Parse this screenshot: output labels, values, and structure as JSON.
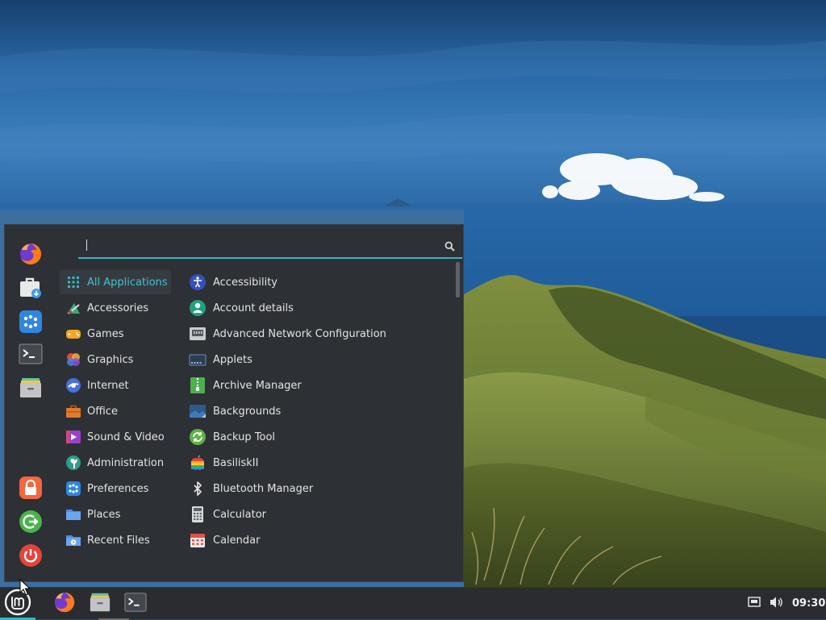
{
  "search": {
    "value": "",
    "placeholder": ""
  },
  "favorites": [
    {
      "name": "Firefox",
      "icon": "firefox-icon"
    },
    {
      "name": "Software Manager",
      "icon": "software-manager-icon"
    },
    {
      "name": "System Settings",
      "icon": "settings-icon"
    },
    {
      "name": "Terminal",
      "icon": "terminal-icon"
    },
    {
      "name": "Files",
      "icon": "files-icon"
    }
  ],
  "session": [
    {
      "name": "Lock Screen",
      "icon": "lock-icon"
    },
    {
      "name": "Log Out",
      "icon": "logout-icon"
    },
    {
      "name": "Quit",
      "icon": "power-icon"
    }
  ],
  "categories": [
    {
      "label": "All Applications",
      "icon": "grid-icon",
      "selected": true
    },
    {
      "label": "Accessories",
      "icon": "accessories-icon"
    },
    {
      "label": "Games",
      "icon": "gamepad-icon"
    },
    {
      "label": "Graphics",
      "icon": "graphics-icon"
    },
    {
      "label": "Internet",
      "icon": "internet-icon"
    },
    {
      "label": "Office",
      "icon": "briefcase-icon"
    },
    {
      "label": "Sound & Video",
      "icon": "media-icon"
    },
    {
      "label": "Administration",
      "icon": "administration-icon"
    },
    {
      "label": "Preferences",
      "icon": "preferences-icon"
    },
    {
      "label": "Places",
      "icon": "folder-icon"
    },
    {
      "label": "Recent Files",
      "icon": "recent-files-icon"
    }
  ],
  "apps": [
    {
      "label": "Accessibility",
      "icon": "accessibility-icon"
    },
    {
      "label": "Account details",
      "icon": "account-icon"
    },
    {
      "label": "Advanced Network Configuration",
      "icon": "network-icon"
    },
    {
      "label": "Applets",
      "icon": "applets-icon"
    },
    {
      "label": "Archive Manager",
      "icon": "archive-icon"
    },
    {
      "label": "Backgrounds",
      "icon": "backgrounds-icon"
    },
    {
      "label": "Backup Tool",
      "icon": "backup-icon"
    },
    {
      "label": "BasiliskII",
      "icon": "apple-icon"
    },
    {
      "label": "Bluetooth Manager",
      "icon": "bluetooth-icon"
    },
    {
      "label": "Calculator",
      "icon": "calculator-icon"
    },
    {
      "label": "Calendar",
      "icon": "calendar-icon"
    }
  ],
  "taskbar": {
    "launchers": [
      {
        "name": "Firefox",
        "icon": "firefox-icon"
      },
      {
        "name": "Files",
        "icon": "files-icon"
      },
      {
        "name": "Terminal",
        "icon": "terminal-icon"
      }
    ],
    "tray": {
      "network_icon": "network-wired-icon",
      "volume_icon": "volume-icon"
    },
    "clock": "09:30"
  },
  "colors": {
    "accent": "#35b7c7",
    "menu_bg": "#2d3035",
    "taskbar_bg": "#2a2c30",
    "selected_text": "#3fc3d0"
  }
}
